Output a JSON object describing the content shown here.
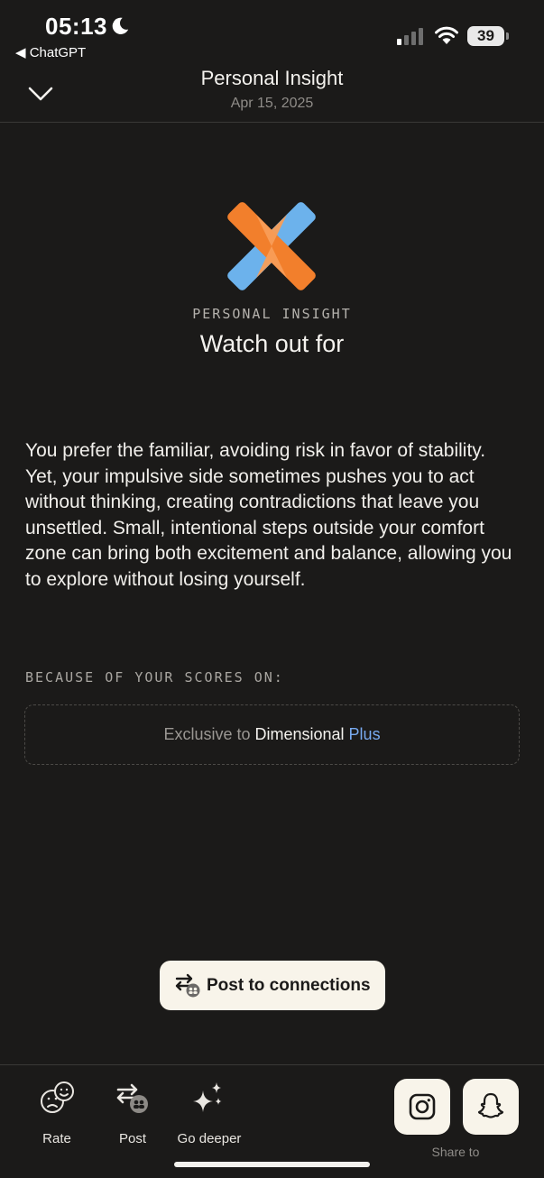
{
  "status_bar": {
    "time": "05:13",
    "back_app": "◀ ChatGPT",
    "battery": "39"
  },
  "header": {
    "title": "Personal Insight",
    "date": "Apr 15, 2025"
  },
  "insight": {
    "eyebrow": "PERSONAL INSIGHT",
    "title": "Watch out for",
    "body": "You prefer the familiar, avoiding risk in favor of stability. Yet, your impulsive side sometimes pushes you to act without thinking, creating contradictions that leave you unsettled. Small, intentional steps outside your comfort zone can bring both excitement and balance, allowing you to explore without losing yourself."
  },
  "scores": {
    "label": "BECAUSE OF YOUR SCORES ON:",
    "exclusive_prefix": "Exclusive to ",
    "exclusive_brand": "Dimensional",
    "exclusive_plus": "Plus"
  },
  "post_button": {
    "label": "Post to connections"
  },
  "bottom_bar": {
    "rate_label": "Rate",
    "post_label": "Post",
    "go_deeper_label": "Go deeper",
    "share_label": "Share to"
  },
  "colors": {
    "background": "#1b1a19",
    "logo_orange": "#f27f2c",
    "logo_light_orange": "#f89d57",
    "logo_blue": "#6cb2ec",
    "plus_accent": "#78aaf0",
    "button_bg": "#f8f4ea"
  },
  "icons": [
    "moon-icon",
    "signal-icon",
    "wifi-icon",
    "chevron-down-icon",
    "rate-face-icon",
    "post-connections-icon",
    "sparkles-icon",
    "instagram-icon",
    "snapchat-icon"
  ]
}
